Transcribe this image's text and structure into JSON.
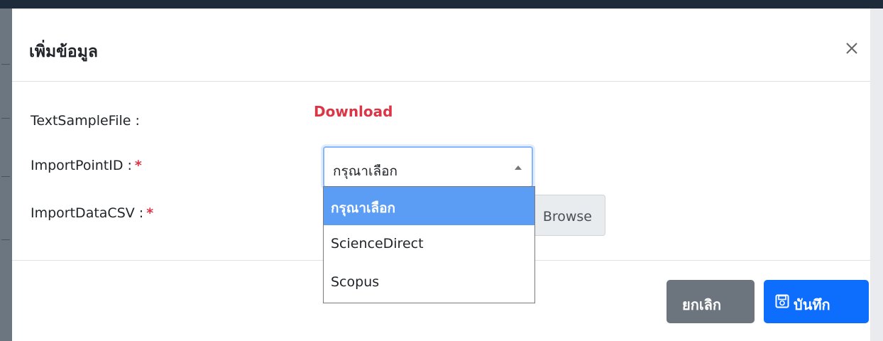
{
  "modal": {
    "title": "เพิ่มข้อมูล",
    "close_symbol": "×"
  },
  "form": {
    "sample_file_label": "TextSampleFile :",
    "download_link": "Download",
    "import_point_label": "ImportPointID :",
    "import_data_label": "ImportDataCSV :",
    "required_mark": "*",
    "select_value": "กรุณาเลือก",
    "browse_label": "Browse",
    "options": [
      "กรุณาเลือก",
      "ScienceDirect",
      "Scopus"
    ]
  },
  "footer": {
    "cancel_label": "ยกเลิก",
    "save_label": "บันทึก"
  },
  "colors": {
    "accent": "#0d6efd",
    "danger": "#dc3545",
    "secondary": "#6c757d",
    "option_highlight": "#5b9cf5"
  },
  "icons": [
    "close-icon",
    "caret-up-icon",
    "save-icon"
  ]
}
